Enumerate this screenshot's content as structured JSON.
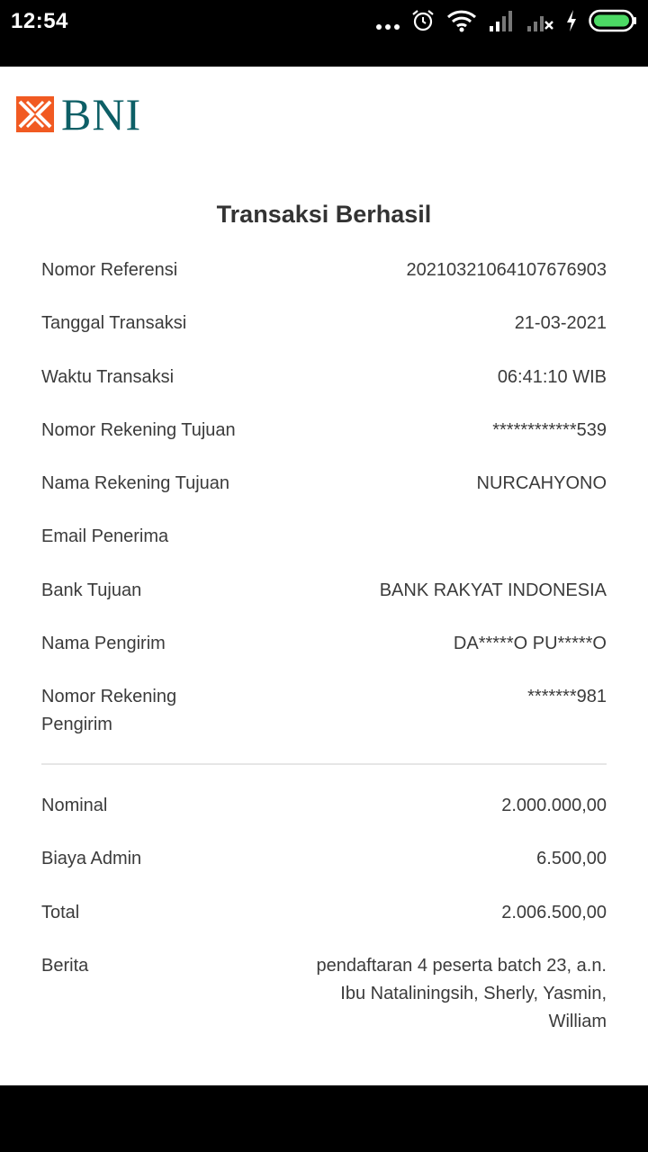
{
  "status_bar": {
    "time": "12:54",
    "icons": [
      "more-dots-icon",
      "alarm-icon",
      "wifi-icon",
      "signal-icon",
      "signal-off-icon",
      "charging-icon",
      "battery-icon"
    ],
    "battery_color": "#4cd964"
  },
  "brand": {
    "logo_text": "BNI",
    "colors": {
      "orange": "#f15a22",
      "teal": "#0d5f66"
    }
  },
  "receipt": {
    "title": "Transaksi Berhasil",
    "rows": [
      {
        "label": "Nomor Referensi",
        "value": "20210321064107676903"
      },
      {
        "label": "Tanggal Transaksi",
        "value": "21-03-2021"
      },
      {
        "label": "Waktu Transaksi",
        "value": "06:41:10 WIB"
      },
      {
        "label": "Nomor Rekening Tujuan",
        "value": "************539"
      },
      {
        "label": "Nama Rekening Tujuan",
        "value": "NURCAHYONO"
      },
      {
        "label": "Email Penerima",
        "value": ""
      },
      {
        "label": "Bank Tujuan",
        "value": "BANK RAKYAT INDONESIA"
      },
      {
        "label": "Nama Pengirim",
        "value": "DA*****O PU*****O"
      },
      {
        "label": "Nomor Rekening Pengirim",
        "value": "*******981"
      }
    ],
    "summary": [
      {
        "label": "Nominal",
        "value": "2.000.000,00"
      },
      {
        "label": "Biaya Admin",
        "value": "6.500,00"
      },
      {
        "label": "Total",
        "value": "2.006.500,00"
      },
      {
        "label": "Berita",
        "value": "pendaftaran 4 peserta batch 23, a.n. Ibu Nataliningsih, Sherly, Yasmin, William"
      }
    ]
  }
}
